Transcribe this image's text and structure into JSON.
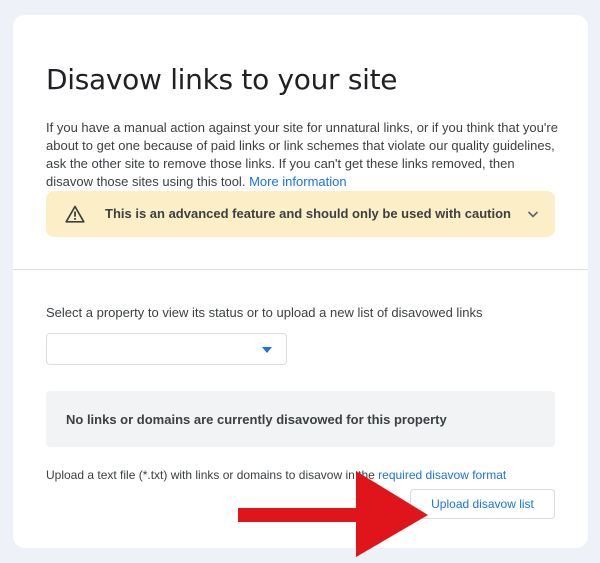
{
  "page": {
    "title": "Disavow links to your site",
    "intro_text": "If you have a manual action against your site for unnatural links, or if you think that you're about to get one because of paid links or link schemes that violate our quality guidelines, ask the other site to remove those links. If you can't get these links removed, then disavow those sites using this tool.",
    "more_info_link": "More information"
  },
  "warning": {
    "icon": "warning-triangle-icon",
    "text": "This is an advanced feature and should only be used with caution",
    "expand_icon": "chevron-down-icon"
  },
  "property": {
    "label": "Select a property to view its status or to upload a new list of disavowed links",
    "selected_value": "",
    "dropdown_icon": "caret-down-icon"
  },
  "status": {
    "text": "No links or domains are currently disavowed for this property"
  },
  "upload": {
    "text_before": "Upload a text file (*.txt) with links or domains to disavow in the",
    "format_link": "required disavow format",
    "button_label": "Upload disavow list"
  },
  "colors": {
    "accent": "#1a73e8",
    "warning_bg": "#fcefc7",
    "annotation_arrow": "#e0141b"
  }
}
